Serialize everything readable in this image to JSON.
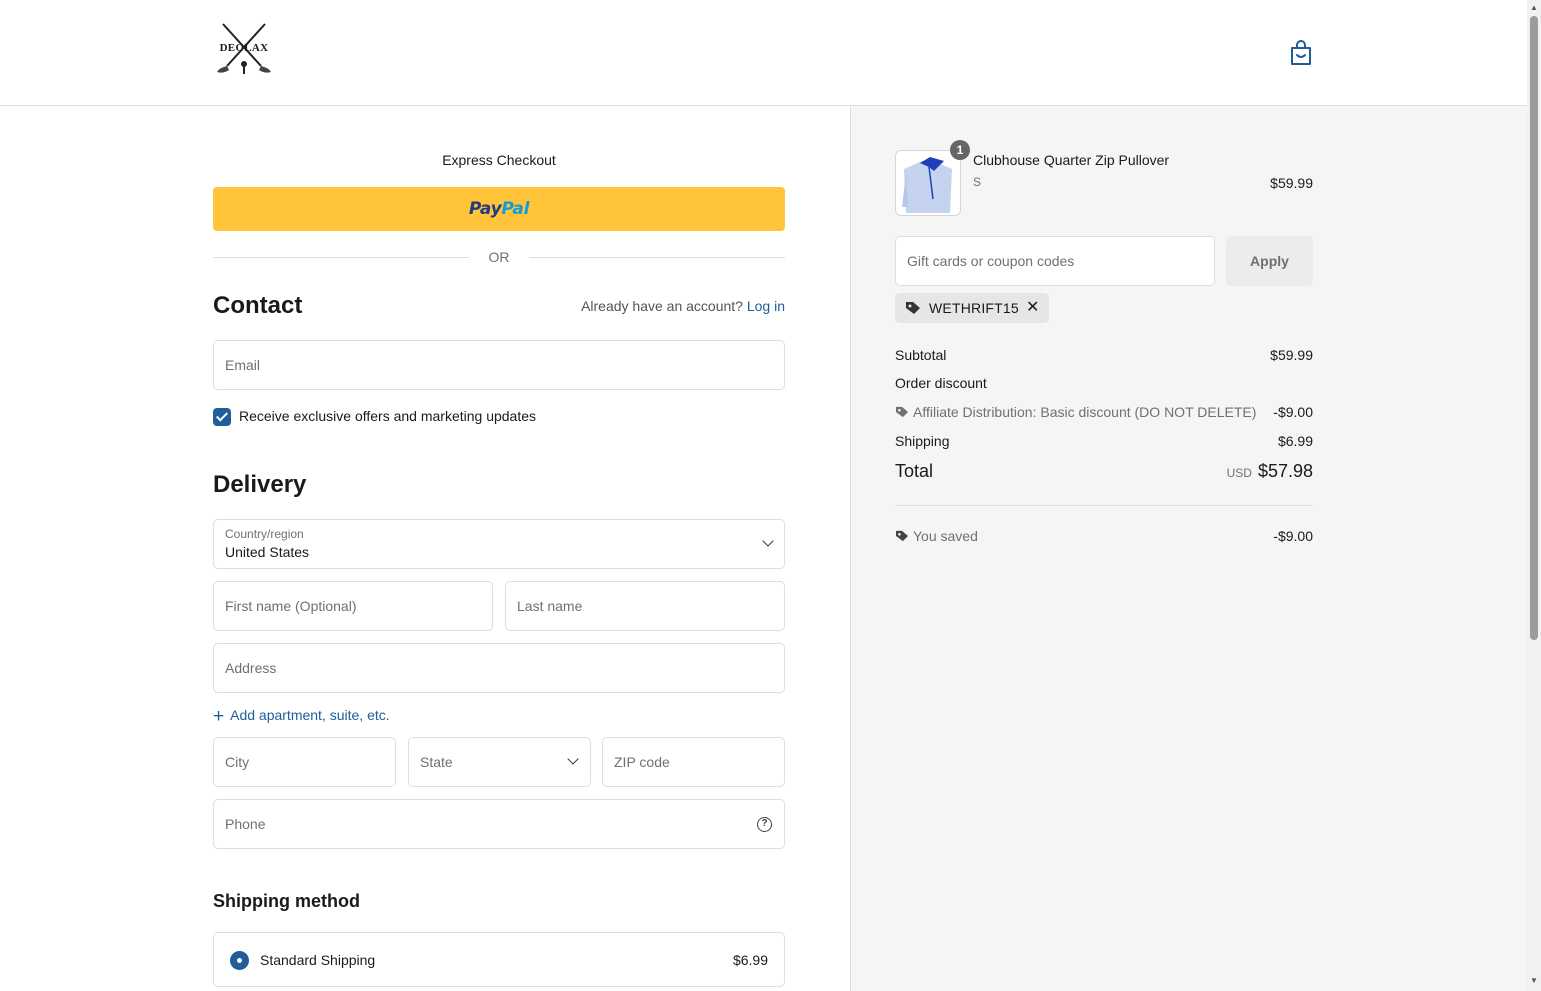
{
  "brand": {
    "name": "DEOLAX"
  },
  "express": {
    "title": "Express Checkout",
    "paypal_a": "Pay",
    "paypal_b": "Pal",
    "or_text": "OR"
  },
  "contact": {
    "heading": "Contact",
    "account_prompt": "Already have an account?",
    "login_label": "Log in",
    "email_placeholder": "Email",
    "marketing_label": "Receive exclusive offers and marketing updates",
    "marketing_checked": true
  },
  "delivery": {
    "heading": "Delivery",
    "country_label": "Country/region",
    "country_value": "United States",
    "first_name_placeholder": "First name (Optional)",
    "last_name_placeholder": "Last name",
    "address_placeholder": "Address",
    "add_apartment_label": "Add apartment, suite, etc.",
    "city_placeholder": "City",
    "state_placeholder": "State",
    "zip_placeholder": "ZIP code",
    "phone_placeholder": "Phone"
  },
  "shipping": {
    "heading": "Shipping method",
    "option_name": "Standard Shipping",
    "option_price": "$6.99"
  },
  "order": {
    "quantity": "1",
    "product_name": "Clubhouse Quarter Zip Pullover",
    "variant": "S",
    "price": "$59.99",
    "coupon_placeholder": "Gift cards or coupon codes",
    "apply_label": "Apply",
    "applied_code": "WETHRIFT15",
    "subtotal_label": "Subtotal",
    "subtotal_value": "$59.99",
    "order_discount_label": "Order discount",
    "discount_name": "Affiliate Distribution: Basic discount (DO NOT DELETE)",
    "discount_value": "-$9.00",
    "shipping_label": "Shipping",
    "shipping_value": "$6.99",
    "total_label": "Total",
    "currency": "USD",
    "total_value": "$57.98",
    "saved_label": "You saved",
    "saved_value": "-$9.00"
  },
  "colors": {
    "accent": "#1f5e9a",
    "paypal_yellow": "#ffc439",
    "summary_bg": "#f5f5f5"
  }
}
